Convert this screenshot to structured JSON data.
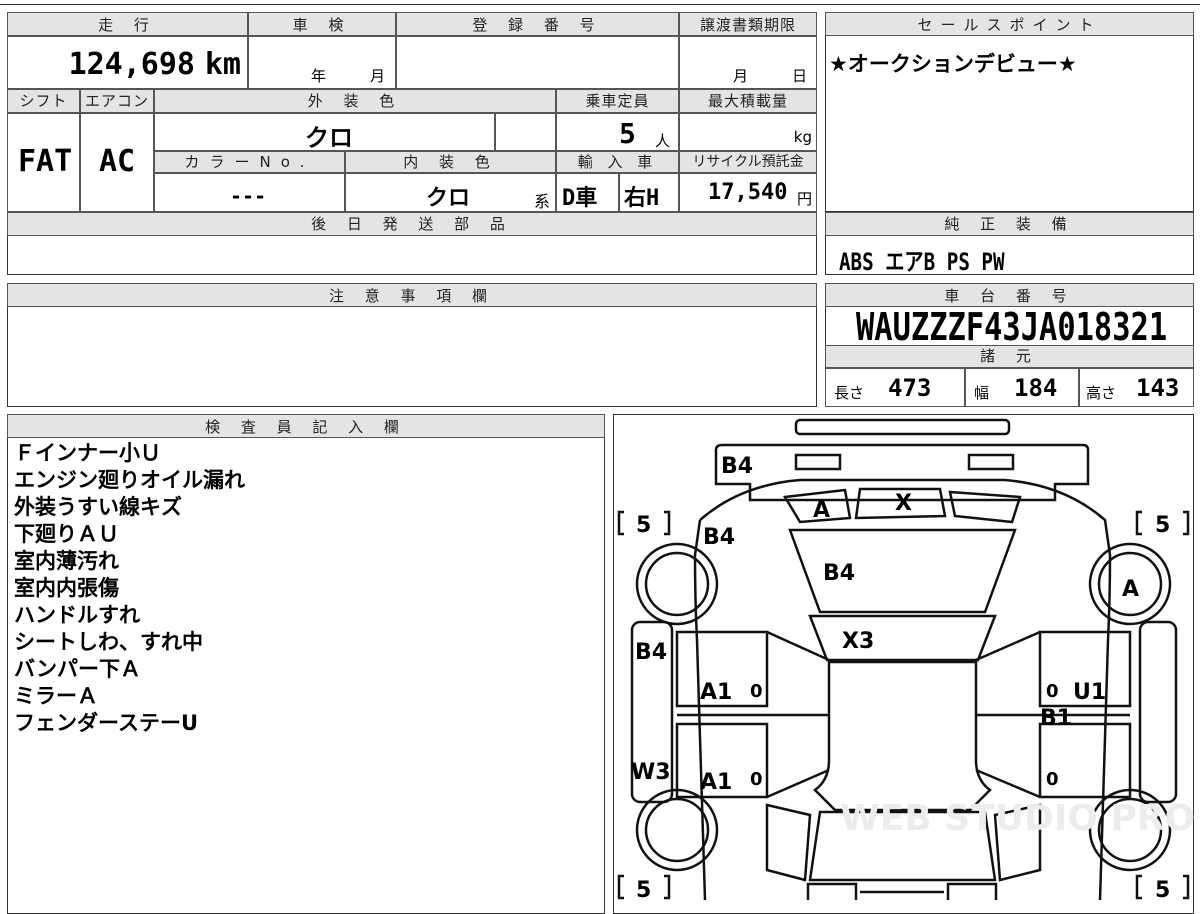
{
  "top_row": {
    "mileage_header": "走 行",
    "mileage_value": "124,698",
    "mileage_unit": "km",
    "inspection_header": "車 検",
    "inspection_year": "年",
    "inspection_month": "月",
    "registration_header": "登 録 番 号",
    "registration_value": "",
    "transfer_header": "譲渡書類期限",
    "transfer_month": "月",
    "transfer_day": "日"
  },
  "sales_point": {
    "header": "セールスポイント",
    "text": "★オークションデビュー★"
  },
  "specs": {
    "shift_header": "シフト",
    "shift_value": "FAT",
    "ac_header": "エアコン",
    "ac_value": "AC",
    "exterior_color_header": "外 装 色",
    "exterior_color_value": "クロ",
    "capacity_header": "乗車定員",
    "capacity_value": "5",
    "capacity_unit": "人",
    "max_load_header": "最大積載量",
    "max_load_unit": "kg",
    "color_no_header": "カラーNo.",
    "color_no_value": "---",
    "interior_color_header": "内 装 色",
    "interior_color_value": "クロ",
    "interior_suffix": "系",
    "import_header": "輸 入 車",
    "import_type": "D車",
    "steering": "右H",
    "recycle_header": "リサイクル預託金",
    "recycle_value": "17,540",
    "recycle_unit": "円"
  },
  "later_parts": {
    "header": "後 日 発 送 部 品",
    "text": ""
  },
  "standard_equipment": {
    "header": "純 正 装 備",
    "text": "ABS エアB PS PW"
  },
  "caution": {
    "header": "注 意 事 項 欄",
    "text": ""
  },
  "chassis": {
    "header": "車 台 番 号",
    "value": "WAUZZZF43JA018321"
  },
  "dimensions": {
    "header": "諸 元",
    "length_label": "長さ",
    "length_value": "473",
    "width_label": "幅",
    "width_value": "184",
    "height_label": "高さ",
    "height_value": "143"
  },
  "inspector": {
    "header": "検 査 員 記 入 欄",
    "notes": [
      "Ｆインナー小Ｕ",
      "エンジン廻りオイル漏れ",
      "外装うすい線キズ",
      "下廻りＡＵ",
      "室内薄汚れ",
      "室内内張傷",
      "ハンドルすれ",
      "シートしわ、すれ中",
      "バンパー下Ａ",
      "ミラーＡ",
      "フェンダーステーU"
    ]
  },
  "diagram": {
    "tire_left_front": "5",
    "tire_right_front": "5",
    "tire_left_rear": "5",
    "tire_right_rear": "5",
    "marks": {
      "front_bumper": "B4",
      "hood_left": "B4",
      "hood": "B4",
      "grille_a": "A",
      "grille_x": "X",
      "windshield": "X3",
      "right_front_wheel": "A",
      "left_fender": "B4",
      "left_front_door": "A1",
      "left_rear_door": "A1",
      "left_sill": "W3",
      "right_front_door": "U1",
      "right_door_b": "B1",
      "door_zero_1": "0",
      "door_zero_2": "0",
      "door_zero_3": "0",
      "door_zero_4": "0"
    },
    "watermark": "WEB STUDIO PRO"
  }
}
